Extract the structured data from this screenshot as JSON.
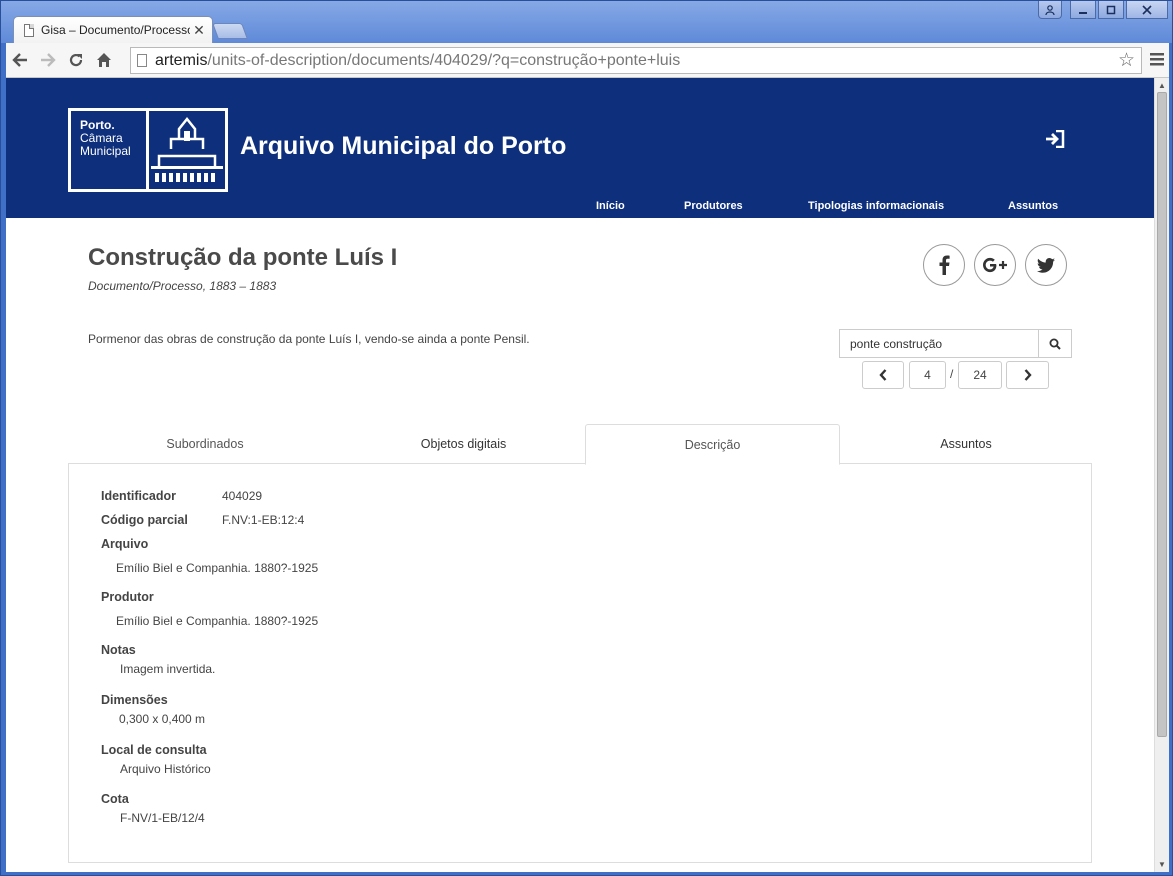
{
  "browser": {
    "tab_title": "Gisa – Documento/Processo",
    "tab_close": "✕",
    "url_host": "artemis",
    "url_path": "/units-of-description/documents/404029/?q=construção+ponte+luis"
  },
  "header": {
    "logo_line1": "Porto.",
    "logo_line2": "Câmara",
    "logo_line3": "Municipal",
    "site_title": "Arquivo Municipal do Porto",
    "nav": [
      "Início",
      "Produtores",
      "Tipologias informacionais",
      "Assuntos"
    ]
  },
  "document": {
    "title": "Construção da ponte Luís I",
    "subtitle": "Documento/Processo, 1883 – 1883",
    "description": "Pormenor das obras de construção da ponte Luís I, vendo-se ainda a ponte Pensil."
  },
  "search": {
    "value": "ponte construção",
    "current_page": "4",
    "separator": "/",
    "total_pages": "24"
  },
  "tabs": [
    "Subordinados",
    "Objetos digitais",
    "Descrição",
    "Assuntos"
  ],
  "fields": {
    "identificador_label": "Identificador",
    "identificador_value": "404029",
    "codigo_label": "Código parcial",
    "codigo_value": "F.NV:1-EB:12:4",
    "arquivo_label": "Arquivo",
    "arquivo_value": "Emílio Biel e Companhia. 1880?-1925",
    "produtor_label": "Produtor",
    "produtor_value": "Emílio Biel e Companhia. 1880?-1925",
    "notas_label": "Notas",
    "notas_value": "Imagem invertida.",
    "dimensoes_label": "Dimensões",
    "dimensoes_value": "0,300 x 0,400 m",
    "local_label": "Local de consulta",
    "local_value": "Arquivo Histórico",
    "cota_label": "Cota",
    "cota_value": "F-NV/1-EB/12/4"
  }
}
